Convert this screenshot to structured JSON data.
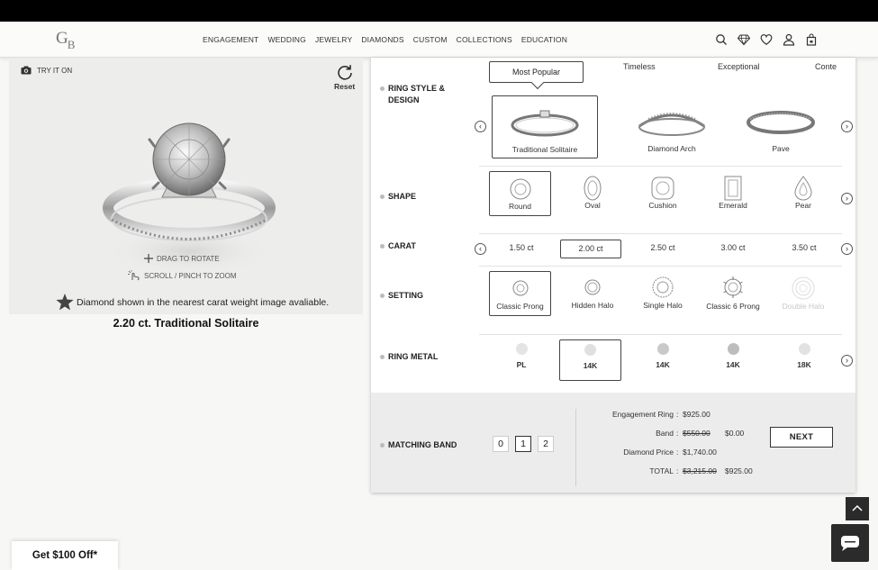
{
  "header": {
    "logo": "GB",
    "nav": [
      "ENGAGEMENT",
      "WEDDING",
      "JEWELRY",
      "DIAMONDS",
      "CUSTOM",
      "COLLECTIONS",
      "EDUCATION"
    ],
    "icons": [
      "search-icon",
      "diamond-icon",
      "heart-icon",
      "user-icon",
      "bag-icon"
    ]
  },
  "viewer": {
    "try_it_on": "TRY IT ON",
    "reset": "Reset",
    "drag_hint": "DRAG TO ROTATE",
    "zoom_hint": "SCROLL / PINCH TO ZOOM",
    "disclaimer": "Diamond shown in the nearest carat weight image avaliable.",
    "product_title": "2.20 ct. Traditional Solitaire"
  },
  "config": {
    "tabs": [
      "Most Popular",
      "Timeless",
      "Exceptional",
      "Conte"
    ],
    "active_tab": "Most Popular",
    "rows": {
      "style": "RING STYLE & DESIGN",
      "shape": "SHAPE",
      "carat": "CARAT",
      "setting": "SETTING",
      "metal": "RING METAL",
      "band": "MATCHING BAND"
    },
    "styles": [
      "Traditional Solitaire",
      "Diamond Arch",
      "Pave"
    ],
    "selected_style": "Traditional Solitaire",
    "shapes": [
      "Round",
      "Oval",
      "Cushion",
      "Emerald",
      "Pear"
    ],
    "selected_shape": "Round",
    "carats": [
      "1.50 ct",
      "2.00 ct",
      "2.50 ct",
      "3.00 ct",
      "3.50 ct"
    ],
    "selected_carat": "2.00 ct",
    "settings": [
      "Classic Prong",
      "Hidden Halo",
      "Single Halo",
      "Classic 6 Prong",
      "Double Halo"
    ],
    "selected_setting": "Classic Prong",
    "metals": [
      "PL",
      "14K",
      "14K",
      "14K",
      "18K"
    ],
    "metal_colors": [
      "#e4e4e4",
      "#e0e0e0",
      "#c9c9c9",
      "#bdbdbd",
      "#e2e2e2"
    ],
    "selected_metal_index": 1,
    "band_qty": [
      "0",
      "1",
      "2"
    ],
    "selected_band_qty": "1"
  },
  "summary": {
    "engagement_ring_label": "Engagement Ring",
    "engagement_ring_price": "$925.00",
    "band_label": "Band",
    "band_old_price": "$550.00",
    "band_price": "$0.00",
    "diamond_label": "Diamond Price",
    "diamond_price": "$1,740.00",
    "total_label": "TOTAL",
    "total_old_price": "$3,215.00",
    "total_price": "$925.00",
    "sep": ":",
    "next": "NEXT"
  },
  "promo": "Get $100 Off*"
}
